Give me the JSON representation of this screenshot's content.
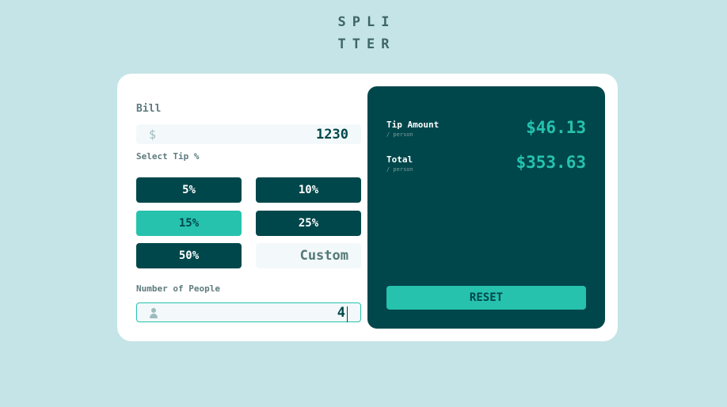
{
  "logo": {
    "line1": "SPLI",
    "line2": "TTER"
  },
  "bill": {
    "label": "Bill",
    "currency_symbol": "$",
    "value": "1230"
  },
  "tip": {
    "label": "Select Tip %",
    "options": [
      "5%",
      "10%",
      "15%",
      "25%",
      "50%"
    ],
    "selected": "15%",
    "custom_placeholder": "Custom"
  },
  "people": {
    "label": "Number of People",
    "value": "4",
    "icon": "user-icon"
  },
  "results": {
    "tip_amount_label": "Tip Amount",
    "tip_amount_sub": "/ person",
    "tip_amount_value": "$46.13",
    "total_label": "Total",
    "total_sub": "/ person",
    "total_value": "$353.63",
    "reset_label": "RESET"
  },
  "colors": {
    "background": "#c5e4e7",
    "card": "#ffffff",
    "dark_cyan": "#00474b",
    "strong_cyan": "#26c2ae",
    "input_bg": "#f3f9fa"
  }
}
